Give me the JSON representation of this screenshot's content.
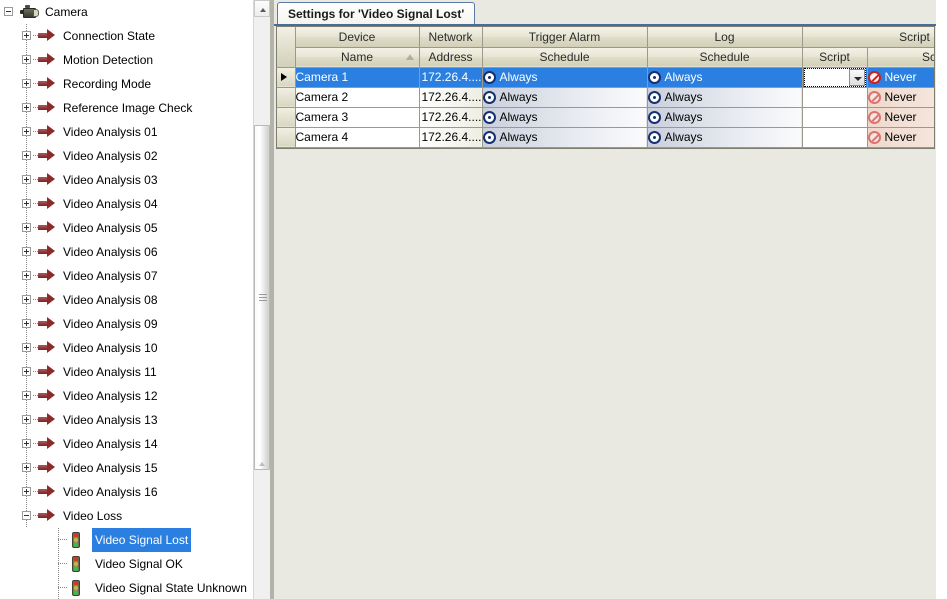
{
  "tree": {
    "root": {
      "label": "Camera",
      "icon": "camera-icon",
      "expanded": true
    },
    "items": [
      {
        "label": "Connection State",
        "icon": "red-arrow-icon",
        "expander": "plus",
        "level": 1
      },
      {
        "label": "Motion Detection",
        "icon": "red-arrow-icon",
        "expander": "plus",
        "level": 1
      },
      {
        "label": "Recording Mode",
        "icon": "red-arrow-icon",
        "expander": "plus",
        "level": 1
      },
      {
        "label": "Reference Image Check",
        "icon": "red-arrow-icon",
        "expander": "plus",
        "level": 1
      },
      {
        "label": "Video Analysis 01",
        "icon": "red-arrow-icon",
        "expander": "plus",
        "level": 1
      },
      {
        "label": "Video Analysis 02",
        "icon": "red-arrow-icon",
        "expander": "plus",
        "level": 1
      },
      {
        "label": "Video Analysis 03",
        "icon": "red-arrow-icon",
        "expander": "plus",
        "level": 1
      },
      {
        "label": "Video Analysis 04",
        "icon": "red-arrow-icon",
        "expander": "plus",
        "level": 1
      },
      {
        "label": "Video Analysis 05",
        "icon": "red-arrow-icon",
        "expander": "plus",
        "level": 1
      },
      {
        "label": "Video Analysis 06",
        "icon": "red-arrow-icon",
        "expander": "plus",
        "level": 1
      },
      {
        "label": "Video Analysis 07",
        "icon": "red-arrow-icon",
        "expander": "plus",
        "level": 1
      },
      {
        "label": "Video Analysis 08",
        "icon": "red-arrow-icon",
        "expander": "plus",
        "level": 1
      },
      {
        "label": "Video Analysis 09",
        "icon": "red-arrow-icon",
        "expander": "plus",
        "level": 1
      },
      {
        "label": "Video Analysis 10",
        "icon": "red-arrow-icon",
        "expander": "plus",
        "level": 1
      },
      {
        "label": "Video Analysis 11",
        "icon": "red-arrow-icon",
        "expander": "plus",
        "level": 1
      },
      {
        "label": "Video Analysis 12",
        "icon": "red-arrow-icon",
        "expander": "plus",
        "level": 1
      },
      {
        "label": "Video Analysis 13",
        "icon": "red-arrow-icon",
        "expander": "plus",
        "level": 1
      },
      {
        "label": "Video Analysis 14",
        "icon": "red-arrow-icon",
        "expander": "plus",
        "level": 1
      },
      {
        "label": "Video Analysis 15",
        "icon": "red-arrow-icon",
        "expander": "plus",
        "level": 1
      },
      {
        "label": "Video Analysis 16",
        "icon": "red-arrow-icon",
        "expander": "plus",
        "level": 1
      },
      {
        "label": "Video Loss",
        "icon": "red-arrow-icon",
        "expander": "minus",
        "level": 1
      },
      {
        "label": "Video Signal Lost",
        "icon": "traffic-light-icon",
        "expander": "none",
        "level": 2,
        "selected": true
      },
      {
        "label": "Video Signal OK",
        "icon": "traffic-light-icon",
        "expander": "none",
        "level": 2
      },
      {
        "label": "Video Signal State Unknown",
        "icon": "traffic-light-icon",
        "expander": "none",
        "level": 2
      }
    ]
  },
  "tab": {
    "label": "Settings for 'Video Signal Lost'"
  },
  "grid": {
    "group_headers": [
      {
        "label": "Device"
      },
      {
        "label": "Network"
      },
      {
        "label": "Trigger Alarm"
      },
      {
        "label": "Log"
      },
      {
        "label": "Script"
      }
    ],
    "sub_headers": [
      {
        "label": "Name",
        "sort": "asc"
      },
      {
        "label": "Address"
      },
      {
        "label": "Schedule"
      },
      {
        "label": "Schedule"
      },
      {
        "label": "Script"
      },
      {
        "label": "Schedule"
      }
    ],
    "rows": [
      {
        "name": "Camera 1",
        "address": "172.26.4....",
        "trigger_schedule": "Always",
        "log_schedule": "Always",
        "script": "<none>",
        "script_schedule": "Never",
        "selected": true,
        "script_editing": true
      },
      {
        "name": "Camera 2",
        "address": "172.26.4....",
        "trigger_schedule": "Always",
        "log_schedule": "Always",
        "script": "<none>",
        "script_schedule": "Never",
        "selected": false,
        "script_editing": false
      },
      {
        "name": "Camera 3",
        "address": "172.26.4....",
        "trigger_schedule": "Always",
        "log_schedule": "Always",
        "script": "<none>",
        "script_schedule": "Never",
        "selected": false,
        "script_editing": false
      },
      {
        "name": "Camera 4",
        "address": "172.26.4....",
        "trigger_schedule": "Always",
        "log_schedule": "Always",
        "script": "<none>",
        "script_schedule": "Never",
        "selected": false,
        "script_editing": false
      }
    ]
  },
  "colors": {
    "selection": "#2a7fe0",
    "tab_border": "#4a6c9b",
    "panel_background": "#e9e9e1",
    "header_gradient_top": "#f3f2e6",
    "header_gradient_bottom": "#d2d0b8",
    "arrow_icon": "#8d2b2b",
    "always_icon": "#16316f",
    "never_icon": "#cc2222"
  }
}
